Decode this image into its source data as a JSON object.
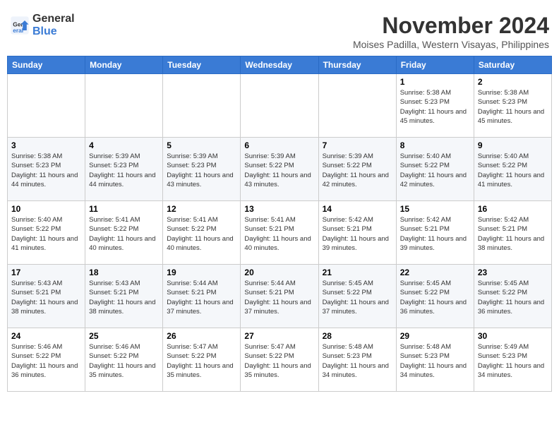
{
  "header": {
    "logo_general": "General",
    "logo_blue": "Blue",
    "month_title": "November 2024",
    "location": "Moises Padilla, Western Visayas, Philippines"
  },
  "days_of_week": [
    "Sunday",
    "Monday",
    "Tuesday",
    "Wednesday",
    "Thursday",
    "Friday",
    "Saturday"
  ],
  "weeks": [
    [
      {
        "day": "",
        "info": ""
      },
      {
        "day": "",
        "info": ""
      },
      {
        "day": "",
        "info": ""
      },
      {
        "day": "",
        "info": ""
      },
      {
        "day": "",
        "info": ""
      },
      {
        "day": "1",
        "info": "Sunrise: 5:38 AM\nSunset: 5:23 PM\nDaylight: 11 hours and 45 minutes."
      },
      {
        "day": "2",
        "info": "Sunrise: 5:38 AM\nSunset: 5:23 PM\nDaylight: 11 hours and 45 minutes."
      }
    ],
    [
      {
        "day": "3",
        "info": "Sunrise: 5:38 AM\nSunset: 5:23 PM\nDaylight: 11 hours and 44 minutes."
      },
      {
        "day": "4",
        "info": "Sunrise: 5:39 AM\nSunset: 5:23 PM\nDaylight: 11 hours and 44 minutes."
      },
      {
        "day": "5",
        "info": "Sunrise: 5:39 AM\nSunset: 5:23 PM\nDaylight: 11 hours and 43 minutes."
      },
      {
        "day": "6",
        "info": "Sunrise: 5:39 AM\nSunset: 5:22 PM\nDaylight: 11 hours and 43 minutes."
      },
      {
        "day": "7",
        "info": "Sunrise: 5:39 AM\nSunset: 5:22 PM\nDaylight: 11 hours and 42 minutes."
      },
      {
        "day": "8",
        "info": "Sunrise: 5:40 AM\nSunset: 5:22 PM\nDaylight: 11 hours and 42 minutes."
      },
      {
        "day": "9",
        "info": "Sunrise: 5:40 AM\nSunset: 5:22 PM\nDaylight: 11 hours and 41 minutes."
      }
    ],
    [
      {
        "day": "10",
        "info": "Sunrise: 5:40 AM\nSunset: 5:22 PM\nDaylight: 11 hours and 41 minutes."
      },
      {
        "day": "11",
        "info": "Sunrise: 5:41 AM\nSunset: 5:22 PM\nDaylight: 11 hours and 40 minutes."
      },
      {
        "day": "12",
        "info": "Sunrise: 5:41 AM\nSunset: 5:22 PM\nDaylight: 11 hours and 40 minutes."
      },
      {
        "day": "13",
        "info": "Sunrise: 5:41 AM\nSunset: 5:21 PM\nDaylight: 11 hours and 40 minutes."
      },
      {
        "day": "14",
        "info": "Sunrise: 5:42 AM\nSunset: 5:21 PM\nDaylight: 11 hours and 39 minutes."
      },
      {
        "day": "15",
        "info": "Sunrise: 5:42 AM\nSunset: 5:21 PM\nDaylight: 11 hours and 39 minutes."
      },
      {
        "day": "16",
        "info": "Sunrise: 5:42 AM\nSunset: 5:21 PM\nDaylight: 11 hours and 38 minutes."
      }
    ],
    [
      {
        "day": "17",
        "info": "Sunrise: 5:43 AM\nSunset: 5:21 PM\nDaylight: 11 hours and 38 minutes."
      },
      {
        "day": "18",
        "info": "Sunrise: 5:43 AM\nSunset: 5:21 PM\nDaylight: 11 hours and 38 minutes."
      },
      {
        "day": "19",
        "info": "Sunrise: 5:44 AM\nSunset: 5:21 PM\nDaylight: 11 hours and 37 minutes."
      },
      {
        "day": "20",
        "info": "Sunrise: 5:44 AM\nSunset: 5:21 PM\nDaylight: 11 hours and 37 minutes."
      },
      {
        "day": "21",
        "info": "Sunrise: 5:45 AM\nSunset: 5:22 PM\nDaylight: 11 hours and 37 minutes."
      },
      {
        "day": "22",
        "info": "Sunrise: 5:45 AM\nSunset: 5:22 PM\nDaylight: 11 hours and 36 minutes."
      },
      {
        "day": "23",
        "info": "Sunrise: 5:45 AM\nSunset: 5:22 PM\nDaylight: 11 hours and 36 minutes."
      }
    ],
    [
      {
        "day": "24",
        "info": "Sunrise: 5:46 AM\nSunset: 5:22 PM\nDaylight: 11 hours and 36 minutes."
      },
      {
        "day": "25",
        "info": "Sunrise: 5:46 AM\nSunset: 5:22 PM\nDaylight: 11 hours and 35 minutes."
      },
      {
        "day": "26",
        "info": "Sunrise: 5:47 AM\nSunset: 5:22 PM\nDaylight: 11 hours and 35 minutes."
      },
      {
        "day": "27",
        "info": "Sunrise: 5:47 AM\nSunset: 5:22 PM\nDaylight: 11 hours and 35 minutes."
      },
      {
        "day": "28",
        "info": "Sunrise: 5:48 AM\nSunset: 5:23 PM\nDaylight: 11 hours and 34 minutes."
      },
      {
        "day": "29",
        "info": "Sunrise: 5:48 AM\nSunset: 5:23 PM\nDaylight: 11 hours and 34 minutes."
      },
      {
        "day": "30",
        "info": "Sunrise: 5:49 AM\nSunset: 5:23 PM\nDaylight: 11 hours and 34 minutes."
      }
    ]
  ]
}
